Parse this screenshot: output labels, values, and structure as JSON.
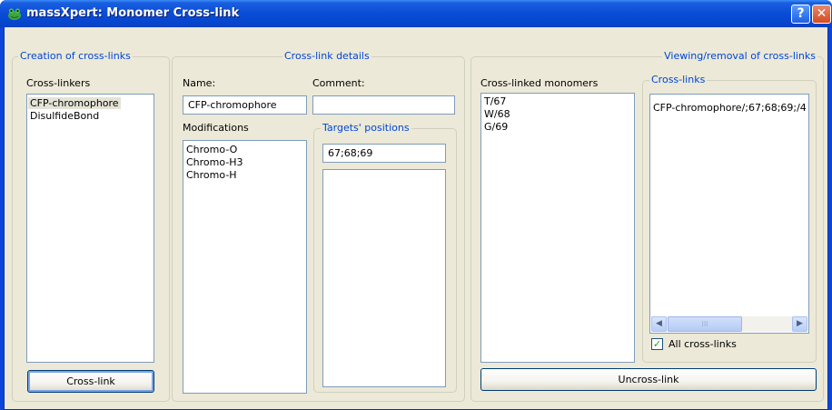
{
  "window": {
    "title": "massXpert: Monomer Cross-link",
    "help_label": "?",
    "close_label": "✕"
  },
  "creation": {
    "group_title": "Creation of cross-links",
    "crosslinkers_label": "Cross-linkers",
    "crosslinkers": [
      "CFP-chromophore",
      "DisulfideBond"
    ],
    "selected_index": 0,
    "crosslink_button": "Cross-link"
  },
  "details": {
    "group_title": "Cross-link details",
    "name_label": "Name:",
    "name_value": "CFP-chromophore",
    "comment_label": "Comment:",
    "comment_value": "",
    "modifications_label": "Modifications",
    "modifications": [
      "Chromo-O",
      "Chromo-H3",
      "Chromo-H"
    ],
    "targets_group_title": "Targets' positions",
    "targets_value": "67;68;69"
  },
  "viewing": {
    "group_title": "Viewing/removal of cross-links",
    "monomers_label": "Cross-linked monomers",
    "monomers": [
      "T/67",
      "W/68",
      "G/69"
    ],
    "crosslinks_group_title": "Cross-links",
    "crosslinks": [
      "CFP-chromophore/;67;68;69;/4"
    ],
    "all_crosslinks_label": "All cross-links",
    "all_crosslinks_checked": true,
    "uncrosslink_button": "Uncross-link"
  },
  "icons": {
    "app": "frog-icon",
    "scroll_left": "◀",
    "scroll_right": "▶",
    "scroll_grip": "III",
    "check": "✓"
  }
}
